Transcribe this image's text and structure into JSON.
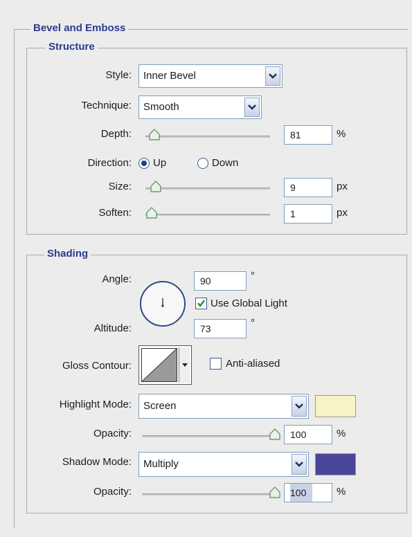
{
  "title": "Bevel and Emboss",
  "structure": {
    "legend": "Structure",
    "style": {
      "label": "Style:",
      "value": "Inner Bevel"
    },
    "technique": {
      "label": "Technique:",
      "value": "Smooth"
    },
    "depth": {
      "label": "Depth:",
      "value": "81",
      "unit": "%"
    },
    "direction": {
      "label": "Direction:",
      "up": "Up",
      "down": "Down",
      "selected": "Up"
    },
    "size": {
      "label": "Size:",
      "value": "9",
      "unit": "px"
    },
    "soften": {
      "label": "Soften:",
      "value": "1",
      "unit": "px"
    }
  },
  "shading": {
    "legend": "Shading",
    "angle": {
      "label": "Angle:",
      "value": "90",
      "unit": "°"
    },
    "use_global_light": {
      "label": "Use Global Light",
      "checked": true
    },
    "altitude": {
      "label": "Altitude:",
      "value": "73",
      "unit": "°"
    },
    "gloss_contour": {
      "label": "Gloss Contour:"
    },
    "anti_aliased": {
      "label": "Anti-aliased",
      "checked": false
    },
    "highlight_mode": {
      "label": "Highlight Mode:",
      "value": "Screen",
      "color": "#f7f3c4"
    },
    "highlight_opacity": {
      "label": "Opacity:",
      "value": "100",
      "unit": "%"
    },
    "shadow_mode": {
      "label": "Shadow Mode:",
      "value": "Multiply",
      "color": "#4a469a"
    },
    "shadow_opacity": {
      "label": "Opacity:",
      "value": "100",
      "unit": "%"
    }
  }
}
